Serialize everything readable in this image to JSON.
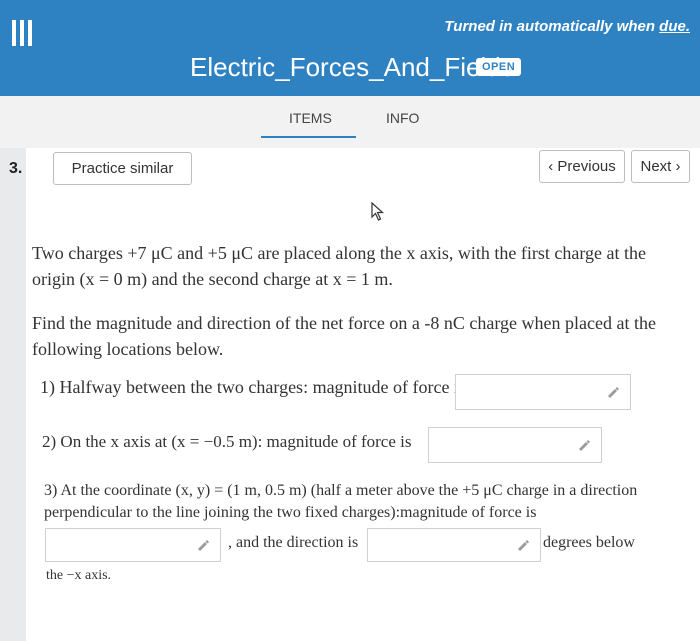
{
  "header": {
    "menu_icon": "hamburger-menu-icon",
    "turned_in_text": "Turned in automatically when",
    "turned_in_due": "due.",
    "title": "Electric_Forces_And_Fields",
    "status_badge": "OPEN",
    "background_color": "#2f82c2"
  },
  "tabs": {
    "items": "ITEMS",
    "info": "INFO"
  },
  "question": {
    "number": "3.",
    "practice_label": "Practice similar",
    "previous_label": "‹ Previous",
    "next_label": "Next ›",
    "para1": "Two charges +7 μC and +5 μC are placed along the x axis, with the first charge at the origin (x = 0 m) and the second charge at x = 1 m.",
    "para2": "Find the magnitude and direction of the net force on a -8 nC charge when placed at the following locations below.",
    "part1": "1) Halfway between the two charges: magnitude of force is",
    "part2": "2) On the x axis at (x = −0.5 m): magnitude of force is",
    "part3": "3) At the coordinate (x, y) = (1 m, 0.5 m) (half a meter above the +5 μC charge in a direction perpendicular to the line joining the two fixed charges):magnitude of force is",
    "direction_label": ", and the direction is",
    "degrees_label": "degrees below",
    "tail": "the −x axis."
  },
  "fields": {
    "f1_value": "",
    "f2_value": "",
    "f3_value": "",
    "f4_value": ""
  }
}
